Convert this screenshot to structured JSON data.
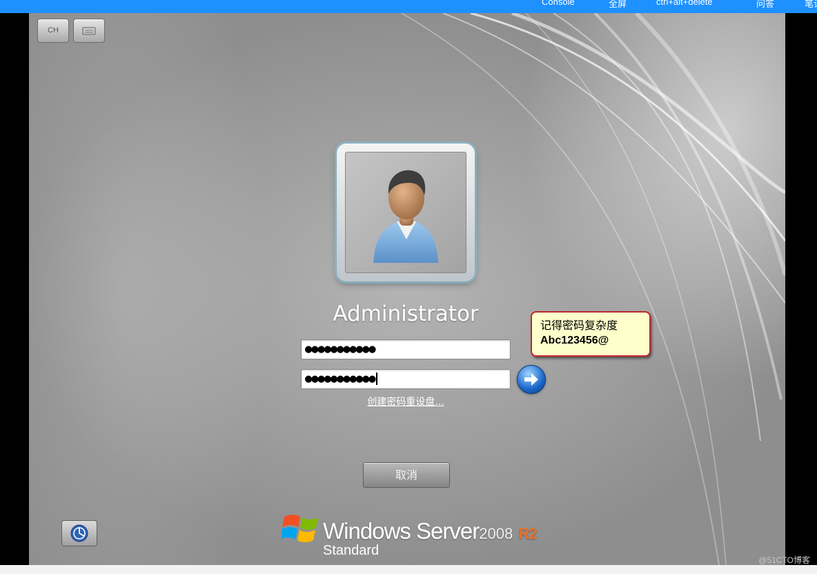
{
  "topbar": {
    "items": [
      "Console",
      "全屏",
      "ctrl+alt+delete",
      "问答",
      "笔记"
    ]
  },
  "toolbar": {
    "lang_label": "CH",
    "keyboard_icon": "keyboard-icon"
  },
  "login": {
    "username": "Administrator",
    "password_masked": "●●●●●●●●●●●",
    "confirm_password_masked": "●●●●●●●●●●●",
    "reset_link": "创建密码重设盘...",
    "cancel_label": "取消",
    "submit_icon": "arrow-right-icon",
    "accessibility_icon": "ease-of-access-icon"
  },
  "callout": {
    "line1": "记得密码复杂度",
    "line2": "Abc123456@"
  },
  "brand": {
    "product": "Windows Server",
    "version": "2008",
    "release": "R2",
    "edition": "Standard"
  },
  "watermark": "@51CTO博客",
  "colors": {
    "topbar": "#1e90ff",
    "callout_border": "#c0262c",
    "callout_bg": "#ffffcc",
    "submit_blue": "#1b66c9"
  }
}
